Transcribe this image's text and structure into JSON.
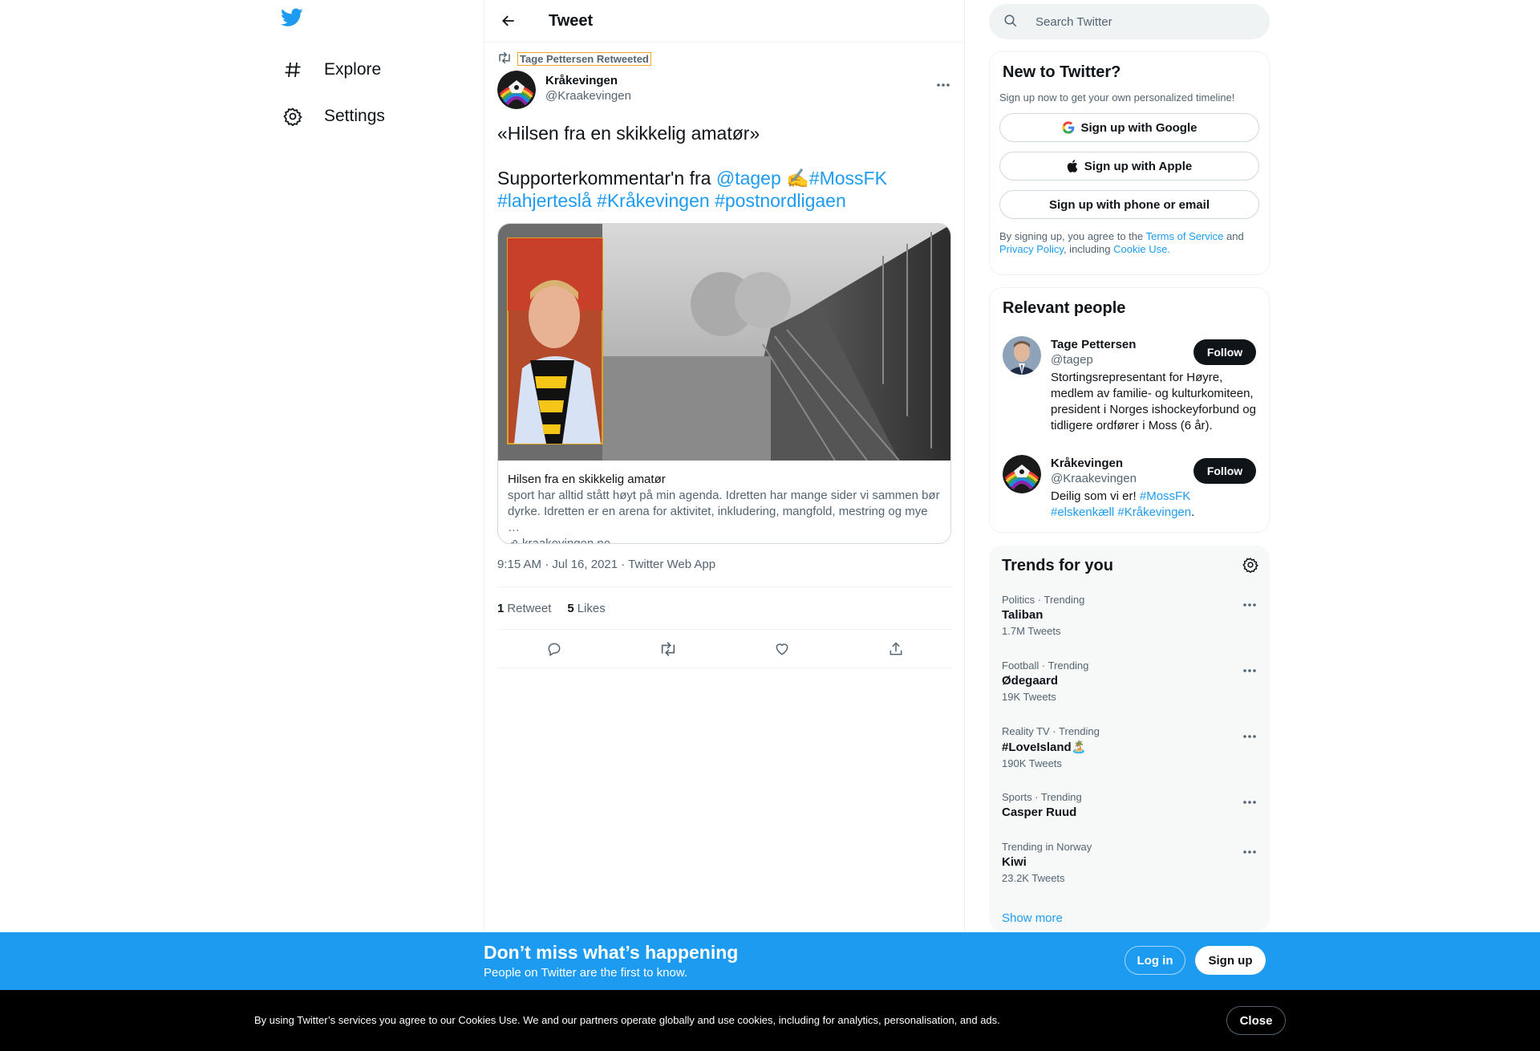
{
  "nav": {
    "items": [
      {
        "label": "Explore",
        "icon": "hashtag-icon"
      },
      {
        "label": "Settings",
        "icon": "gear-icon"
      }
    ]
  },
  "header": {
    "title": "Tweet"
  },
  "tweet": {
    "retweeted_by": "Tage Pettersen Retweeted",
    "author_name": "Kråkevingen",
    "author_handle": "@Kraakevingen",
    "text_line1": "«Hilsen fra en skikkelig amatør»",
    "text_line2_prefix": "Supporterkommentar'n fra ",
    "mention": "@tagep",
    "emoji": "✍️",
    "hashtag_mossfk": "#MossFK",
    "hashtag_lahjerteslaa": "#lahjerteslå",
    "hashtag_kraakevingen": "#Kråkevingen",
    "hashtag_postnordligaen": "#postnordligaen",
    "card": {
      "title": "Hilsen fra en skikkelig amatør",
      "description": "sport har alltid stått høyt på min agenda. Idretten har mange sider vi sammen bør dyrke. Idretten er en arena for aktivitet, inkludering, mangfold, mestring og mye …",
      "domain": "kraakevingen.no"
    },
    "timestamp": "9:15 AM · Jul 16, 2021 · Twitter Web App",
    "retweet_count": "1",
    "retweet_label": "Retweet",
    "like_count": "5",
    "like_label": "Likes"
  },
  "search": {
    "placeholder": "Search Twitter"
  },
  "new_to_twitter": {
    "title": "New to Twitter?",
    "subtitle": "Sign up now to get your own personalized timeline!",
    "google": "Sign up with Google",
    "apple": "Sign up with Apple",
    "phone": "Sign up with phone or email",
    "legal_prefix": "By signing up, you agree to the ",
    "terms": "Terms of Service",
    "and": " and",
    "privacy": "Privacy Policy",
    "including": ", including ",
    "cookie": "Cookie Use."
  },
  "relevant": {
    "title": "Relevant people",
    "follow_label": "Follow",
    "people": [
      {
        "name": "Tage Pettersen",
        "handle": "@tagep",
        "bio": "Stortingsrepresentant for Høyre, medlem av familie- og kulturkomiteen, president i Norges ishockeyforbund og tidligere ordfører i Moss (6 år)."
      },
      {
        "name": "Kråkevingen",
        "handle": "@Kraakevingen",
        "bio_prefix": "Deilig som vi er! ",
        "bio_tag1": "#MossFK",
        "bio_tag2": "#elskenkæll",
        "bio_tag3": "#Kråkevingen",
        "bio_suffix": "."
      }
    ]
  },
  "trends": {
    "title": "Trends for you",
    "items": [
      {
        "context": "Politics · Trending",
        "name": "Taliban",
        "count": "1.7M Tweets"
      },
      {
        "context": "Football · Trending",
        "name": "Ødegaard",
        "count": "19K Tweets"
      },
      {
        "context": "Reality TV · Trending",
        "name": "#LoveIsland🏝️",
        "count": "190K Tweets"
      },
      {
        "context": "Sports · Trending",
        "name": "Casper Ruud",
        "count": ""
      },
      {
        "context": "Trending in Norway",
        "name": "Kiwi",
        "count": "23.2K Tweets"
      }
    ],
    "show_more": "Show more"
  },
  "banner": {
    "title": "Don’t miss what’s happening",
    "subtitle": "People on Twitter are the first to know.",
    "login": "Log in",
    "signup": "Sign up"
  },
  "cookie_bar": {
    "text": "By using Twitter’s services you agree to our Cookies Use. We and our partners operate globally and use cookies, including for analytics, personalisation, and ads.",
    "close": "Close"
  },
  "colors": {
    "accent": "#1d9bf0",
    "text": "#0f1419",
    "secondary": "#536471"
  }
}
